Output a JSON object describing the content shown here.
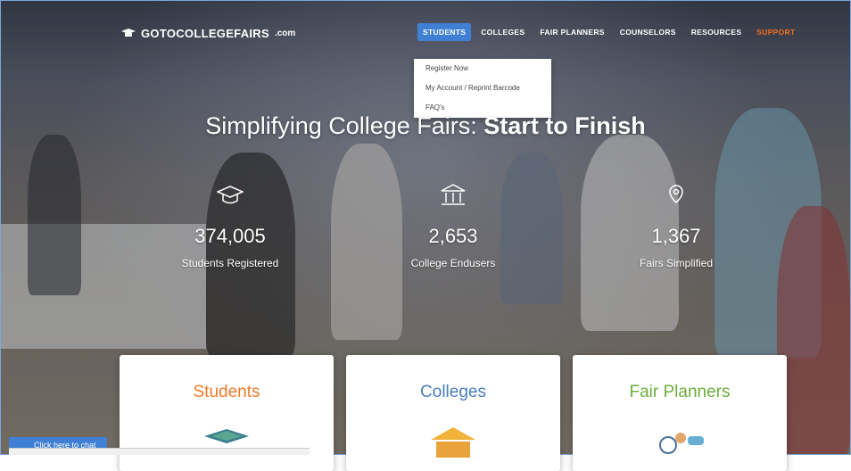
{
  "header": {
    "brand": "GOTOCOLLEGEFAIRS",
    "brand_suffix": ".com",
    "nav": {
      "students": "STUDENTS",
      "colleges": "COLLEGES",
      "fair_planners": "FAIR PLANNERS",
      "counselors": "COUNSELORS",
      "resources": "RESOURCES",
      "support": "SUPPORT"
    }
  },
  "dropdown": {
    "items": [
      "Register Now",
      "My Account / Reprint Barcode",
      "FAQ's"
    ]
  },
  "hero": {
    "title_plain": "Simplifying College Fairs: ",
    "title_bold": "Start to Finish"
  },
  "stats": [
    {
      "icon": "graduation-cap-icon",
      "value": "374,005",
      "label": "Students Registered"
    },
    {
      "icon": "college-building-icon",
      "value": "2,653",
      "label": "College Endusers"
    },
    {
      "icon": "map-pin-icon",
      "value": "1,367",
      "label": "Fairs Simplified"
    }
  ],
  "cards": [
    {
      "title": "Students",
      "color": "#f07a2a"
    },
    {
      "title": "Colleges",
      "color": "#4a7cc0"
    },
    {
      "title": "Fair Planners",
      "color": "#6cae3c"
    }
  ],
  "chat": {
    "label": "Click here to chat"
  },
  "colors": {
    "accent": "#3f7fd4",
    "support": "#f36f21"
  }
}
